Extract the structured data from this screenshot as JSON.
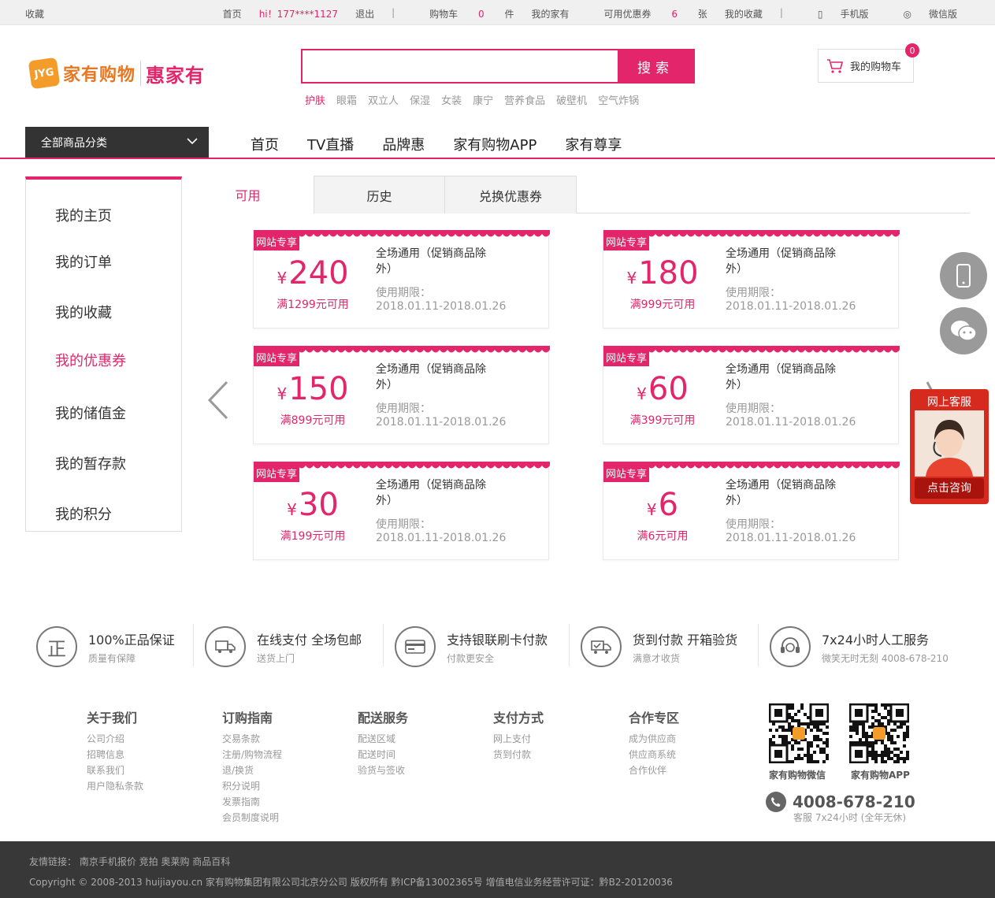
{
  "topbar": {
    "favorite": "收藏",
    "home": "首页",
    "greeting": "hi！177****1127",
    "logout": "退出",
    "cart_label": "购物车",
    "cart_count": "0",
    "cart_unit": "件",
    "my_jiayou": "我的家有",
    "coupon_label": "可用优惠券",
    "coupon_count": "6",
    "coupon_unit": "张",
    "my_fav": "我的收藏",
    "mobile": "手机版",
    "wechat": "微信版",
    "sep": "|"
  },
  "header": {
    "logo_badge": "JYG",
    "logo_name": "家有购物",
    "logo_name2": "惠家有",
    "search_button": "搜索",
    "search_placeholder": "",
    "hot_words": [
      "护肤",
      "眼霜",
      "双立人",
      "保湿",
      "女装",
      "康宁",
      "营养食品",
      "破壁机",
      "空气炸锅"
    ],
    "cart_label": "我的购物车",
    "cart_badge": "0"
  },
  "nav": {
    "all_categories": "全部商品分类",
    "items": [
      "首页",
      "TV直播",
      "品牌惠",
      "家有购物APP",
      "家有尊享"
    ]
  },
  "sidebar": {
    "items": [
      "我的主页",
      "我的订单",
      "我的收藏",
      "我的优惠券",
      "我的储值金",
      "我的暂存款",
      "我的积分"
    ],
    "active_index": 3
  },
  "tabs": [
    "可用",
    "历史",
    "兑换优惠券"
  ],
  "coupons": [
    {
      "tag": "网站专享",
      "yen": "¥",
      "amount": "240",
      "condition": "满1299元可用",
      "desc": "全场通用（促销商品除外）",
      "period_label": "使用期限：",
      "period": "2018.01.11-2018.01.26"
    },
    {
      "tag": "网站专享",
      "yen": "¥",
      "amount": "180",
      "condition": "满999元可用",
      "desc": "全场通用（促销商品除外）",
      "period_label": "使用期限：",
      "period": "2018.01.11-2018.01.26"
    },
    {
      "tag": "网站专享",
      "yen": "¥",
      "amount": "150",
      "condition": "满899元可用",
      "desc": "全场通用（促销商品除外）",
      "period_label": "使用期限：",
      "period": "2018.01.11-2018.01.26"
    },
    {
      "tag": "网站专享",
      "yen": "¥",
      "amount": "60",
      "condition": "满399元可用",
      "desc": "全场通用（促销商品除外）",
      "period_label": "使用期限：",
      "period": "2018.01.11-2018.01.26"
    },
    {
      "tag": "网站专享",
      "yen": "¥",
      "amount": "30",
      "condition": "满199元可用",
      "desc": "全场通用（促销商品除外）",
      "period_label": "使用期限：",
      "period": "2018.01.11-2018.01.26"
    },
    {
      "tag": "网站专享",
      "yen": "¥",
      "amount": "6",
      "condition": "满6元可用",
      "desc": "全场通用（促销商品除外）",
      "period_label": "使用期限：",
      "period": "2018.01.11-2018.01.26"
    }
  ],
  "service": {
    "title": "网上客服",
    "cta": "点击咨询"
  },
  "guarantees": [
    {
      "icon": "正",
      "title": "100%正品保证",
      "sub": "质量有保障"
    },
    {
      "icon": "truck-icon",
      "title": "在线支付 全场包邮",
      "sub": "送货上门"
    },
    {
      "icon": "card-icon",
      "title": "支持银联刷卡付款",
      "sub": "付款更安全"
    },
    {
      "icon": "delivery-check-icon",
      "title": "货到付款 开箱验货",
      "sub": "满意才收货"
    },
    {
      "icon": "headset-icon",
      "title": "7x24小时人工服务",
      "sub": "微笑无时无刻 4008-678-210"
    }
  ],
  "footer_cols": [
    {
      "title": "关于我们",
      "links": [
        "公司介绍",
        "招聘信息",
        "联系我们",
        "用户隐私条款"
      ]
    },
    {
      "title": "订购指南",
      "links": [
        "交易条款",
        "注册/购物流程",
        "退/换货",
        "积分说明",
        "发票指南",
        "会员制度说明"
      ]
    },
    {
      "title": "配送服务",
      "links": [
        "配送区域",
        "配送时间",
        "验货与签收"
      ]
    },
    {
      "title": "支付方式",
      "links": [
        "网上支付",
        "货到付款"
      ]
    },
    {
      "title": "合作专区",
      "links": [
        "成为供应商",
        "供应商系统",
        "合作伙伴"
      ]
    }
  ],
  "qr": {
    "wechat_label": "家有购物微信",
    "app_label": "家有购物APP"
  },
  "hotline": {
    "number": "4008-678-210",
    "sub": "客服 7x24小时 (全年无休)"
  },
  "bottom": {
    "friend_links": "友情链接：  南京手机报价  竞拍  奥莱购  商品百科",
    "copyright": "Copyright © 2008-2013 huijiayou.cn 家有购物集团有限公司北京分公司 版权所有 黔ICP备13002365号 增值电信业务经营许可证：黔B2-20120036"
  },
  "colors": {
    "brand": "#e3256b",
    "logo_orange": "#e87722",
    "service_red": "#d62a1f",
    "dark": "#333333"
  }
}
